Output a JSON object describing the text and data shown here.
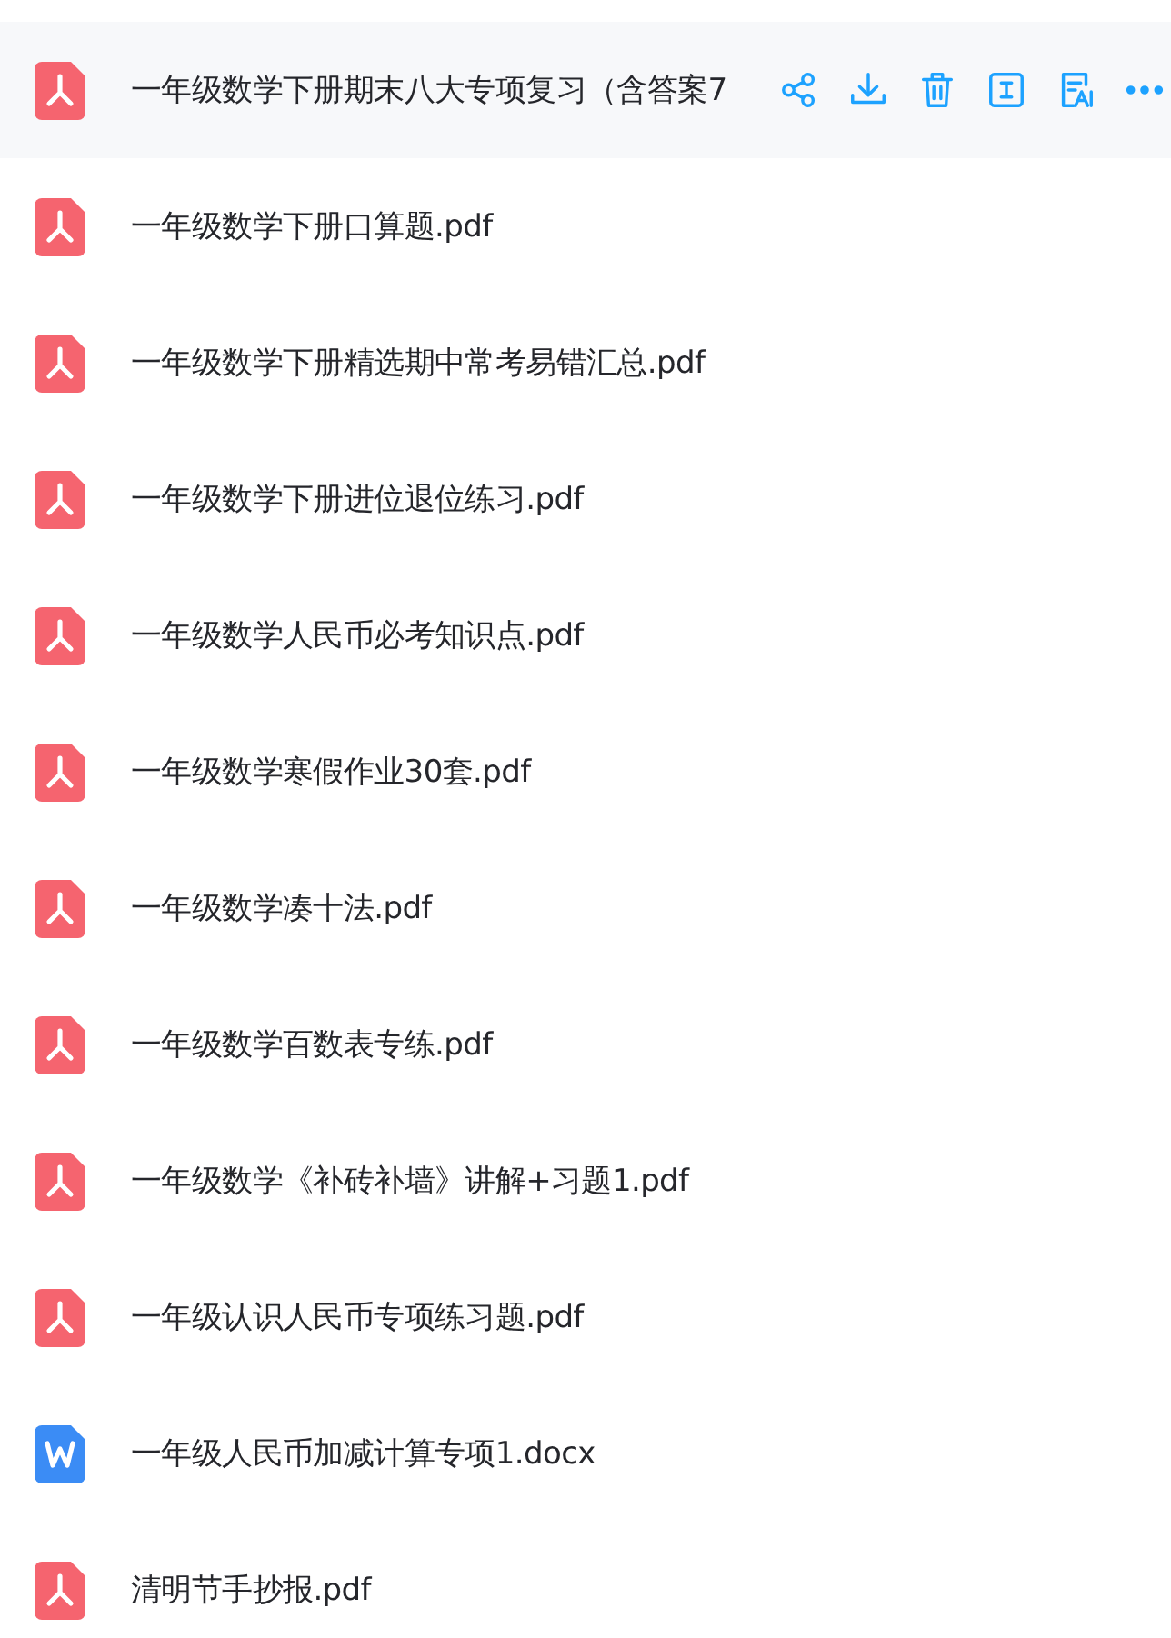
{
  "files": [
    {
      "kind": "pdf",
      "name": "一年级数学下册期末八大专项复习（含答案7",
      "selected": true
    },
    {
      "kind": "pdf",
      "name": "一年级数学下册口算题.pdf",
      "selected": false
    },
    {
      "kind": "pdf",
      "name": "一年级数学下册精选期中常考易错汇总.pdf",
      "selected": false
    },
    {
      "kind": "pdf",
      "name": "一年级数学下册进位退位练习.pdf",
      "selected": false
    },
    {
      "kind": "pdf",
      "name": "一年级数学人民币必考知识点.pdf",
      "selected": false
    },
    {
      "kind": "pdf",
      "name": "一年级数学寒假作业30套.pdf",
      "selected": false
    },
    {
      "kind": "pdf",
      "name": "一年级数学凑十法.pdf",
      "selected": false
    },
    {
      "kind": "pdf",
      "name": "一年级数学百数表专练.pdf",
      "selected": false
    },
    {
      "kind": "pdf",
      "name": "一年级数学《补砖补墙》讲解+习题1.pdf",
      "selected": false
    },
    {
      "kind": "pdf",
      "name": "一年级认识人民币专项练习题.pdf",
      "selected": false
    },
    {
      "kind": "docx",
      "name": "一年级人民币加减计算专项1.docx",
      "selected": false
    },
    {
      "kind": "pdf",
      "name": "清明节手抄报.pdf",
      "selected": false
    }
  ]
}
